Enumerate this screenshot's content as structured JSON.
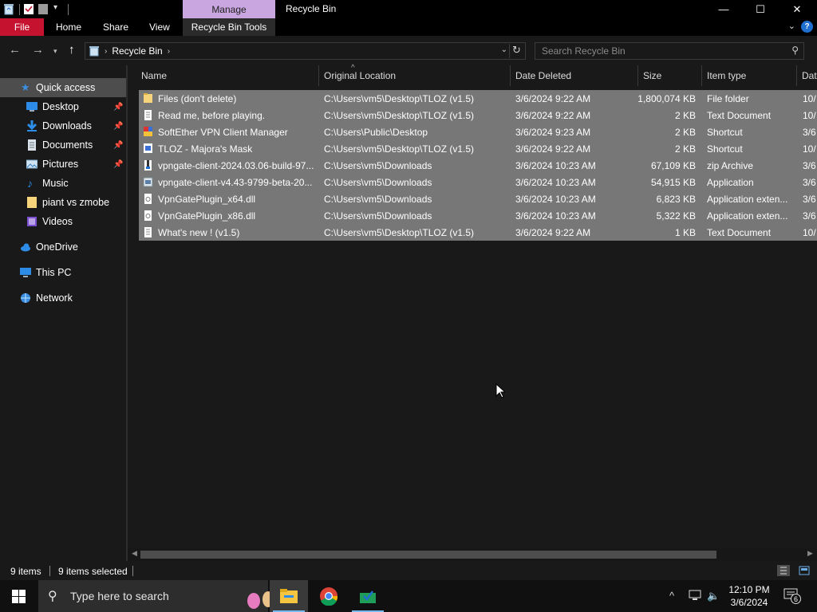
{
  "window": {
    "title": "Recycle Bin",
    "context_tab": "Manage",
    "controls": {
      "minimize": "—",
      "maximize": "☐",
      "close": "✕"
    }
  },
  "ribbon": {
    "tabs": [
      "File",
      "Home",
      "Share",
      "View",
      "Recycle Bin Tools"
    ],
    "help": "?"
  },
  "address": {
    "crumbs": [
      "Recycle Bin"
    ],
    "search_placeholder": "Search Recycle Bin"
  },
  "sidebar": {
    "items": [
      {
        "label": "Quick access",
        "icon": "star-icon",
        "selected": true
      },
      {
        "label": "Desktop",
        "icon": "desktop-icon",
        "pinned": true
      },
      {
        "label": "Downloads",
        "icon": "download-icon",
        "pinned": true
      },
      {
        "label": "Documents",
        "icon": "documents-icon",
        "pinned": true
      },
      {
        "label": "Pictures",
        "icon": "pictures-icon",
        "pinned": true
      },
      {
        "label": "Music",
        "icon": "music-icon"
      },
      {
        "label": "piant vs zmobe",
        "icon": "folder-icon"
      },
      {
        "label": "Videos",
        "icon": "videos-icon"
      },
      {
        "label": "OneDrive",
        "icon": "cloud-icon"
      },
      {
        "label": "This PC",
        "icon": "computer-icon"
      },
      {
        "label": "Network",
        "icon": "network-icon"
      }
    ]
  },
  "columns": [
    "Name",
    "Original Location",
    "Date Deleted",
    "Size",
    "Item type",
    "Dat"
  ],
  "files": [
    {
      "name": "Files (don't delete)",
      "location": "C:\\Users\\vm5\\Desktop\\TLOZ (v1.5)",
      "date": "3/6/2024 9:22 AM",
      "size": "1,800,074 KB",
      "type": "File folder",
      "date2": "10/",
      "icon": "folder-icon"
    },
    {
      "name": "Read me, before playing.",
      "location": "C:\\Users\\vm5\\Desktop\\TLOZ (v1.5)",
      "date": "3/6/2024 9:22 AM",
      "size": "2 KB",
      "type": "Text Document",
      "date2": "10/",
      "icon": "text-file-icon"
    },
    {
      "name": "SoftEther VPN Client Manager",
      "location": "C:\\Users\\Public\\Desktop",
      "date": "3/6/2024 9:23 AM",
      "size": "2 KB",
      "type": "Shortcut",
      "date2": "3/6",
      "icon": "vpn-shortcut-icon"
    },
    {
      "name": "TLOZ - Majora's Mask",
      "location": "C:\\Users\\vm5\\Desktop\\TLOZ (v1.5)",
      "date": "3/6/2024 9:22 AM",
      "size": "2 KB",
      "type": "Shortcut",
      "date2": "10/",
      "icon": "game-shortcut-icon"
    },
    {
      "name": "vpngate-client-2024.03.06-build-97...",
      "location": "C:\\Users\\vm5\\Downloads",
      "date": "3/6/2024 10:23 AM",
      "size": "67,109 KB",
      "type": "zip Archive",
      "date2": "3/6",
      "icon": "zip-icon"
    },
    {
      "name": "vpngate-client-v4.43-9799-beta-20...",
      "location": "C:\\Users\\vm5\\Downloads",
      "date": "3/6/2024 10:23 AM",
      "size": "54,915 KB",
      "type": "Application",
      "date2": "3/6",
      "icon": "application-icon"
    },
    {
      "name": "VpnGatePlugin_x64.dll",
      "location": "C:\\Users\\vm5\\Downloads",
      "date": "3/6/2024 10:23 AM",
      "size": "6,823 KB",
      "type": "Application exten...",
      "date2": "3/6",
      "icon": "dll-icon"
    },
    {
      "name": "VpnGatePlugin_x86.dll",
      "location": "C:\\Users\\vm5\\Downloads",
      "date": "3/6/2024 10:23 AM",
      "size": "5,322 KB",
      "type": "Application exten...",
      "date2": "3/6",
      "icon": "dll-icon"
    },
    {
      "name": "What's new ! (v1.5)",
      "location": "C:\\Users\\vm5\\Desktop\\TLOZ (v1.5)",
      "date": "3/6/2024 9:22 AM",
      "size": "1 KB",
      "type": "Text Document",
      "date2": "10/",
      "icon": "text-file-icon"
    }
  ],
  "status": {
    "count": "9 items",
    "selected": "9 items selected"
  },
  "taskbar": {
    "search_placeholder": "Type here to search",
    "time": "12:10 PM",
    "date": "3/6/2024",
    "notifications": "6"
  },
  "colors": {
    "selection": "#777777",
    "file_tab": "#c4122f",
    "manage_tab": "#c9a6e0",
    "accent": "#76b9ed"
  }
}
